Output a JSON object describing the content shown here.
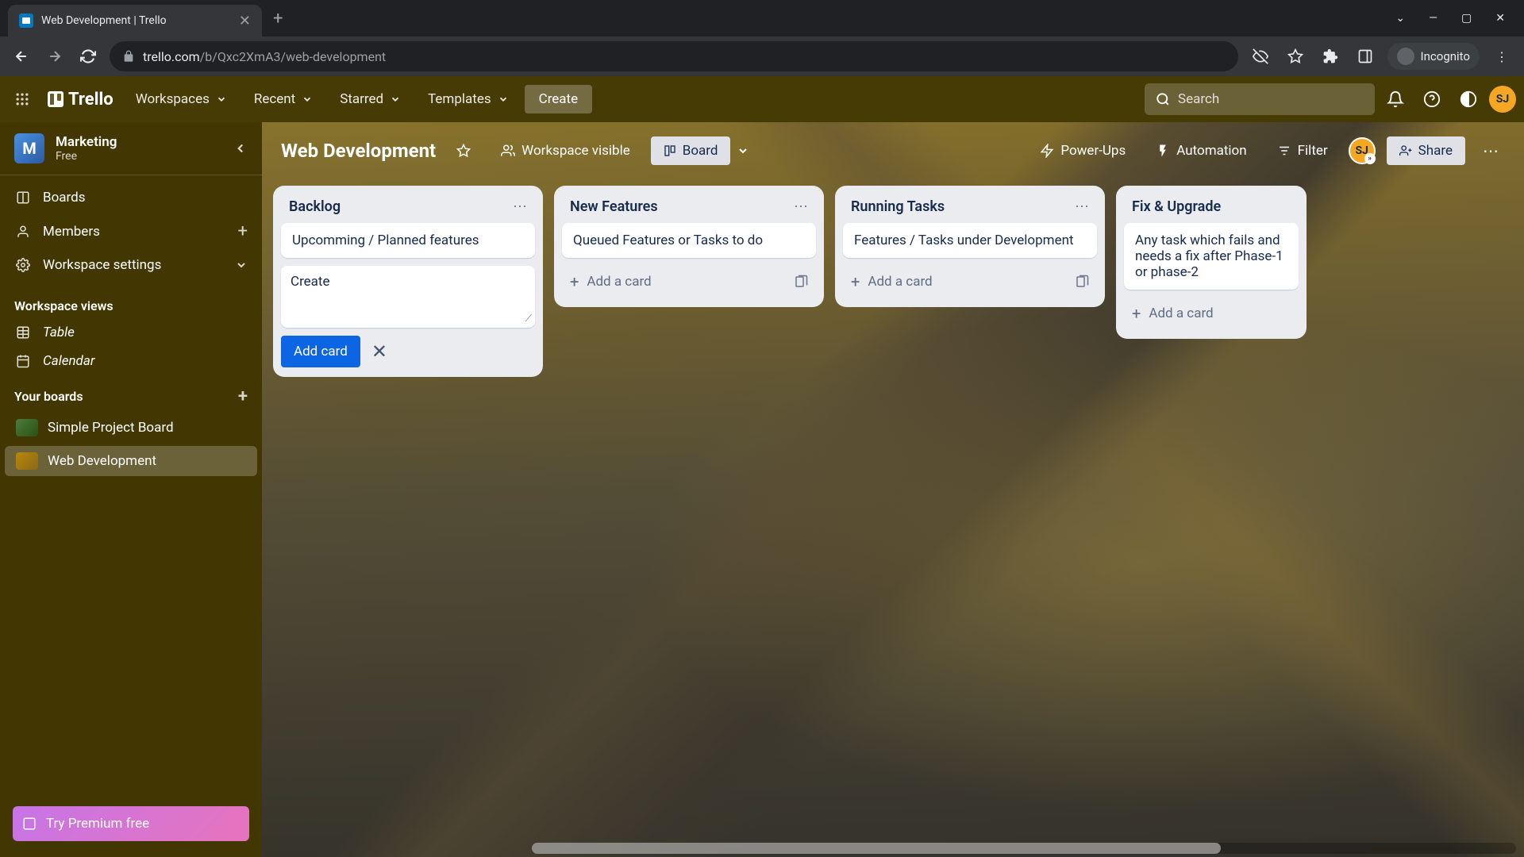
{
  "browser": {
    "tab_title": "Web Development | Trello",
    "url_domain": "trello.com",
    "url_path": "/b/Qxc2XmA3/web-development",
    "incognito_label": "Incognito"
  },
  "header": {
    "logo_text": "Trello",
    "nav": {
      "workspaces": "Workspaces",
      "recent": "Recent",
      "starred": "Starred",
      "templates": "Templates",
      "create": "Create"
    },
    "search_placeholder": "Search",
    "avatar_initials": "SJ"
  },
  "sidebar": {
    "workspace_initial": "M",
    "workspace_name": "Marketing",
    "workspace_plan": "Free",
    "items": {
      "boards": "Boards",
      "members": "Members",
      "settings": "Workspace settings"
    },
    "views_heading": "Workspace views",
    "views": {
      "table": "Table",
      "calendar": "Calendar"
    },
    "boards_heading": "Your boards",
    "boards": [
      {
        "name": "Simple Project Board"
      },
      {
        "name": "Web Development"
      }
    ],
    "premium_label": "Try Premium free"
  },
  "board": {
    "title": "Web Development",
    "visibility": "Workspace visible",
    "view_label": "Board",
    "powerups": "Power-Ups",
    "automation": "Automation",
    "filter": "Filter",
    "share": "Share",
    "avatar_initials": "SJ"
  },
  "lists": [
    {
      "title": "Backlog",
      "cards": [
        "Upcomming / Planned features"
      ],
      "composer_value": "Create",
      "add_label": "Add card"
    },
    {
      "title": "New Features",
      "cards": [
        "Queued Features or Tasks to do"
      ],
      "add_link": "Add a card"
    },
    {
      "title": "Running Tasks",
      "cards": [
        "Features / Tasks under Development"
      ],
      "add_link": "Add a card"
    },
    {
      "title": "Fix & Upgrade",
      "cards": [
        "Any task which fails and needs a fix after Phase-1 or phase-2"
      ],
      "add_link": "Add a card"
    }
  ]
}
